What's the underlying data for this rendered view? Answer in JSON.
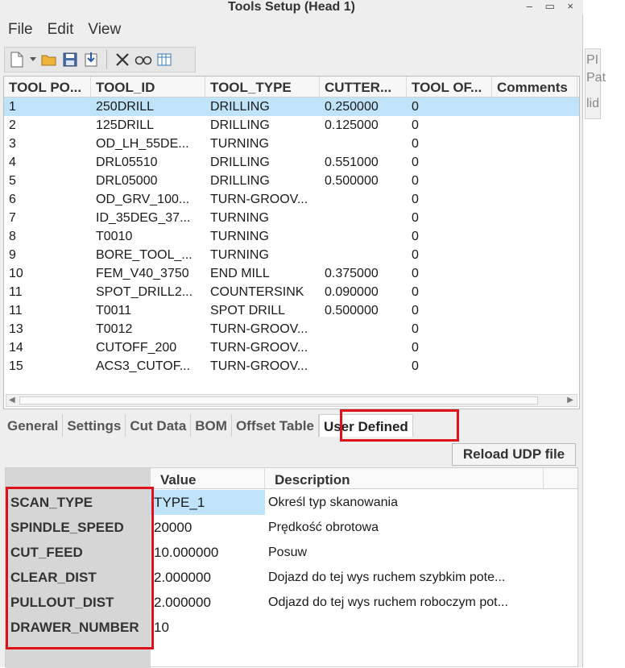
{
  "window": {
    "title": "Tools Setup (Head 1)",
    "controls": [
      "–",
      "▭",
      "×"
    ]
  },
  "menu": [
    "File",
    "Edit",
    "View"
  ],
  "toolbar": {
    "icons": [
      "new-document-icon",
      "open-folder-icon",
      "save-icon",
      "import-icon",
      "delete-icon",
      "preview-icon",
      "columns-icon"
    ]
  },
  "tools": {
    "columns": [
      "TOOL PO...",
      "TOOL_ID",
      "TOOL_TYPE",
      "CUTTER...",
      "TOOL OF...",
      "Comments"
    ],
    "rows": [
      [
        "1",
        "250DRILL",
        "DRILLING",
        "0.250000",
        "0",
        ""
      ],
      [
        "2",
        "125DRILL",
        "DRILLING",
        "0.125000",
        "0",
        ""
      ],
      [
        "3",
        "OD_LH_55DE...",
        "TURNING",
        "",
        "0",
        ""
      ],
      [
        "4",
        "DRL05510",
        "DRILLING",
        "0.551000",
        "0",
        ""
      ],
      [
        "5",
        "DRL05000",
        "DRILLING",
        "0.500000",
        "0",
        ""
      ],
      [
        "6",
        "OD_GRV_100...",
        "TURN-GROOV...",
        "",
        "0",
        ""
      ],
      [
        "7",
        "ID_35DEG_37...",
        "TURNING",
        "",
        "0",
        ""
      ],
      [
        "8",
        "T0010",
        "TURNING",
        "",
        "0",
        ""
      ],
      [
        "9",
        "BORE_TOOL_...",
        "TURNING",
        "",
        "0",
        ""
      ],
      [
        "10",
        "FEM_V40_3750",
        "END MILL",
        "0.375000",
        "0",
        ""
      ],
      [
        "11",
        "SPOT_DRILL2...",
        "COUNTERSINK",
        "0.090000",
        "0",
        ""
      ],
      [
        "11",
        "T0011",
        "SPOT DRILL",
        "0.500000",
        "0",
        ""
      ],
      [
        "13",
        "T0012",
        "TURN-GROOV...",
        "",
        "0",
        ""
      ],
      [
        "14",
        "CUTOFF_200",
        "TURN-GROOV...",
        "",
        "0",
        ""
      ],
      [
        "15",
        "ACS3_CUTOF...",
        "TURN-GROOV...",
        "",
        "0",
        ""
      ]
    ],
    "selected_row": 0
  },
  "tabs": [
    "General",
    "Settings",
    "Cut Data",
    "BOM",
    "Offset Table",
    "User Defined"
  ],
  "active_tab": "User Defined",
  "reload_button": "Reload UDP file",
  "udp": {
    "columns": [
      "Value",
      "Description"
    ],
    "rows": [
      {
        "name": "SCAN_TYPE",
        "value": "TYPE_1",
        "description": "Określ typ skanowania"
      },
      {
        "name": "SPINDLE_SPEED",
        "value": "20000",
        "description": "Prędkość obrotowa"
      },
      {
        "name": "CUT_FEED",
        "value": "10.000000",
        "description": "Posuw"
      },
      {
        "name": "CLEAR_DIST",
        "value": "2.000000",
        "description": "Dojazd do tej wys ruchem szybkim pote..."
      },
      {
        "name": "PULLOUT_DIST",
        "value": "2.000000",
        "description": "Odjazd do tej wys ruchem roboczym pot..."
      },
      {
        "name": "DRAWER_NUMBER",
        "value": "10",
        "description": ""
      }
    ]
  },
  "side_fragments": [
    "PI",
    "Pat",
    "lid"
  ],
  "colors": {
    "highlight_red": "#e0101a",
    "selection_blue": "#bfe3f9"
  }
}
